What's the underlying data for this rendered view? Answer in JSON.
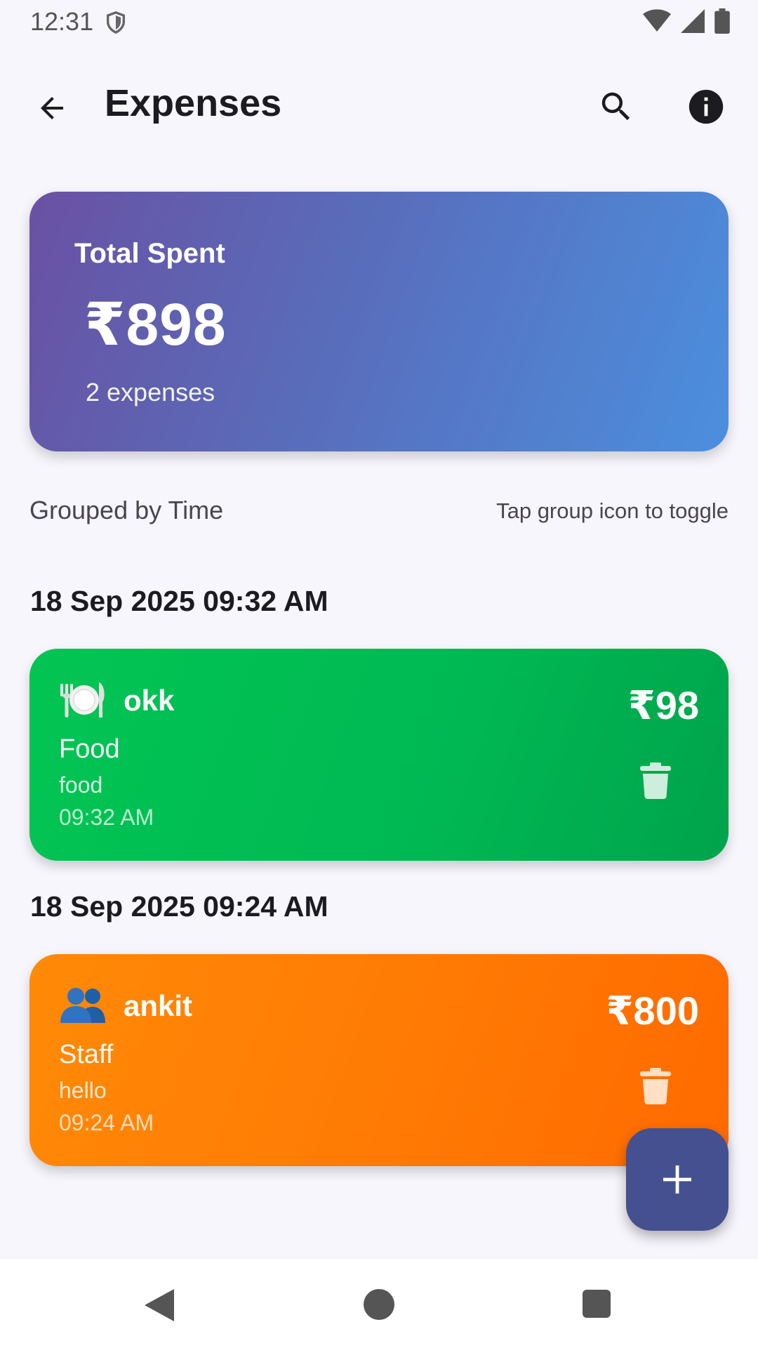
{
  "status_bar": {
    "time": "12:31"
  },
  "app_bar": {
    "title": "Expenses"
  },
  "summary": {
    "label": "Total Spent",
    "amount": "₹898",
    "count": "2 expenses"
  },
  "grouping": {
    "label": "Grouped by Time",
    "hint": "Tap group icon to toggle"
  },
  "groups": [
    {
      "date": "18 Sep 2025 09:32 AM",
      "expense": {
        "icon": "plate-cutlery-icon",
        "name": "okk",
        "category": "Food",
        "note": "food",
        "time": "09:32 AM",
        "amount": "₹98",
        "color": "#00b853"
      }
    },
    {
      "date": "18 Sep 2025 09:24 AM",
      "expense": {
        "icon": "people-icon",
        "name": "ankit",
        "category": "Staff",
        "note": "hello",
        "time": "09:24 AM",
        "amount": "₹800",
        "color": "#ff7a04"
      }
    }
  ],
  "fab": {
    "icon": "plus-icon"
  },
  "colors": {
    "summary_start": "#6a51a3",
    "summary_end": "#4b8fde",
    "fab": "#44508f",
    "background": "#f7f6fc"
  }
}
